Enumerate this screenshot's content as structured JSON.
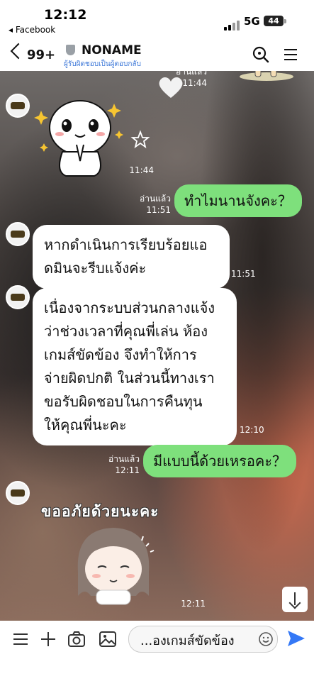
{
  "status_bar": {
    "time": "12:12",
    "back_app": "◂ Facebook",
    "network": "5G",
    "battery": "44"
  },
  "header": {
    "back_count": "99+",
    "title": "NONAME",
    "subtitle": "ผู้รับผิดชอบเป็นผู้ตอบกลับ"
  },
  "messages": [
    {
      "side": "left",
      "kind": "sticker",
      "time": "11:44"
    },
    {
      "side": "right",
      "kind": "text",
      "read": "อ่านแล้ว",
      "time": "11:51",
      "text": "ทำไมนานจังคะ？"
    },
    {
      "side": "left",
      "kind": "text",
      "time": "11:51",
      "lines": [
        "หากดำเนินการเรียบร้อยแอ",
        "ดมินจะรีบแจ้งค่ะ"
      ]
    },
    {
      "side": "left",
      "kind": "text",
      "time": "12:10",
      "lines": [
        "เนื่องจากระบบส่วนกลางแจ้ง",
        "ว่าช่วงเวลาที่คุณพี่เล่น ห้อง",
        "เกมส์ขัดข้อง จึงทำให้การ",
        "จ่ายผิดปกติ ในส่วนนี้ทางเรา",
        "ขอรับผิดชอบในการคืนทุน",
        "ให้คุณพี่นะคะ"
      ]
    },
    {
      "side": "right",
      "kind": "text",
      "read": "อ่านแล้ว",
      "time": "12:11",
      "text": "มีแบบนี้ด้วยเหรอคะ？"
    },
    {
      "side": "left",
      "kind": "sticker",
      "time": "12:11",
      "sticker_text": "ขออภัยด้วยนะคะ"
    }
  ],
  "top_partial": {
    "read": "อ่านแล้ว",
    "time": "11:44"
  },
  "input": {
    "value": "...องเกมส์ขัดข้อง"
  },
  "colors": {
    "my_bubble": "#7ee07c",
    "their_bubble": "#ffffff",
    "send": "#3478f6",
    "link": "#3d78d8"
  },
  "icons": [
    "menu-icon",
    "plus-icon",
    "camera-icon",
    "image-icon",
    "emoji-icon",
    "send-icon",
    "search-icon",
    "hamburger-icon",
    "chevron-left-icon",
    "shield-icon",
    "arrow-down-icon"
  ]
}
